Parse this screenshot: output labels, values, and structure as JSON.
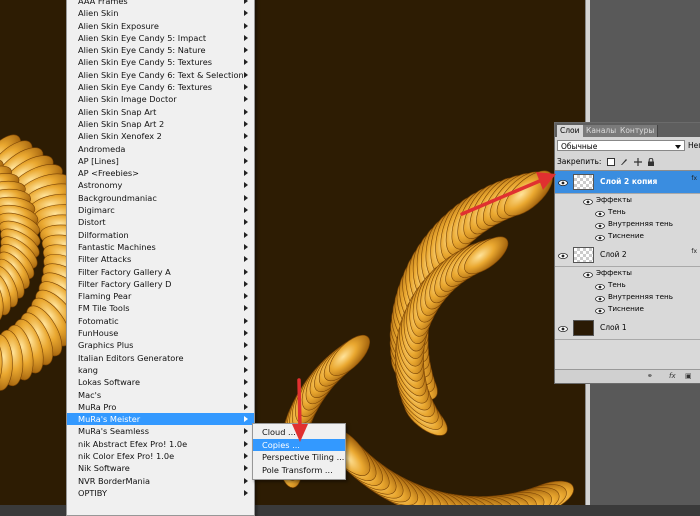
{
  "filter_menu": {
    "items": [
      {
        "label": "AAA Frames",
        "arrow": true
      },
      {
        "label": "Alien Skin",
        "arrow": true
      },
      {
        "label": "Alien Skin Exposure",
        "arrow": true
      },
      {
        "label": "Alien Skin Eye Candy 5: Impact",
        "arrow": true
      },
      {
        "label": "Alien Skin Eye Candy 5: Nature",
        "arrow": true
      },
      {
        "label": "Alien Skin Eye Candy 5: Textures",
        "arrow": true
      },
      {
        "label": "Alien Skin Eye Candy 6: Text & Selection",
        "arrow": true
      },
      {
        "label": "Alien Skin Eye Candy 6: Textures",
        "arrow": true
      },
      {
        "label": "Alien Skin Image Doctor",
        "arrow": true
      },
      {
        "label": "Alien Skin Snap Art",
        "arrow": true
      },
      {
        "label": "Alien Skin Snap Art 2",
        "arrow": true
      },
      {
        "label": "Alien Skin Xenofex 2",
        "arrow": true
      },
      {
        "label": "Andromeda",
        "arrow": true
      },
      {
        "label": "AP [Lines]",
        "arrow": true
      },
      {
        "label": "AP <Freebies>",
        "arrow": true
      },
      {
        "label": "Astronomy",
        "arrow": true
      },
      {
        "label": "Backgroundmaniac",
        "arrow": true
      },
      {
        "label": "Digimarc",
        "arrow": true
      },
      {
        "label": "Distort",
        "arrow": true
      },
      {
        "label": "Dilformation",
        "arrow": true
      },
      {
        "label": "Fantastic Machines",
        "arrow": true
      },
      {
        "label": "Filter Attacks",
        "arrow": true
      },
      {
        "label": "Filter Factory Gallery A",
        "arrow": true
      },
      {
        "label": "Filter Factory Gallery D",
        "arrow": true
      },
      {
        "label": "Flaming Pear",
        "arrow": true
      },
      {
        "label": "FM Tile Tools",
        "arrow": true
      },
      {
        "label": "Fotomatic",
        "arrow": true
      },
      {
        "label": "FunHouse",
        "arrow": true
      },
      {
        "label": "Graphics Plus",
        "arrow": true
      },
      {
        "label": "Italian Editors Generatore",
        "arrow": true
      },
      {
        "label": "kang",
        "arrow": true
      },
      {
        "label": "Lokas Software",
        "arrow": true
      },
      {
        "label": "Mac's",
        "arrow": true
      },
      {
        "label": "MuRa Pro",
        "arrow": true
      },
      {
        "label": "MuRa's Meister",
        "arrow": true,
        "highlight": true
      },
      {
        "label": "MuRa's Seamless",
        "arrow": true
      },
      {
        "label": "nik Abstract Efex Pro! 1.0e",
        "arrow": true
      },
      {
        "label": "nik Color Efex Pro! 1.0e",
        "arrow": true
      },
      {
        "label": "Nik Software",
        "arrow": true
      },
      {
        "label": "NVR BorderMania",
        "arrow": true
      },
      {
        "label": "OPTIBY",
        "arrow": true
      }
    ]
  },
  "submenu": {
    "items": [
      {
        "label": "Cloud ..."
      },
      {
        "label": "Copies ...",
        "highlight": true
      },
      {
        "label": "Perspective Tiling ..."
      },
      {
        "label": "Pole Transform ..."
      }
    ]
  },
  "layers_panel": {
    "tabs": [
      "Слои",
      "Каналы",
      "Контуры"
    ],
    "blend_mode": "Обычные",
    "opacity_label": "Непр",
    "lock_label": "Закрепить:",
    "layers": [
      {
        "name": "Слой 2 копия",
        "selected": true,
        "thumb": "transparent",
        "effects_label": "Эффекты",
        "effects": [
          "Тень",
          "Внутренняя тень",
          "Тиснение"
        ]
      },
      {
        "name": "Слой 2",
        "selected": false,
        "thumb": "transparent",
        "effects_label": "Эффекты",
        "effects": [
          "Тень",
          "Внутренняя тень",
          "Тиснение"
        ]
      },
      {
        "name": "Слой 1",
        "selected": false,
        "thumb": "dark",
        "effects": []
      }
    ],
    "bottom_icons": [
      "link-icon",
      "fx-icon",
      "mask-icon"
    ],
    "fx_symbol": "fx"
  },
  "colors": {
    "menu_highlight": "#3399ff",
    "layer_selected": "#3a8de0",
    "annotation_arrow": "#e03030",
    "canvas_bg": "#2d1c03",
    "artwork_gold": "#e8a52a"
  }
}
